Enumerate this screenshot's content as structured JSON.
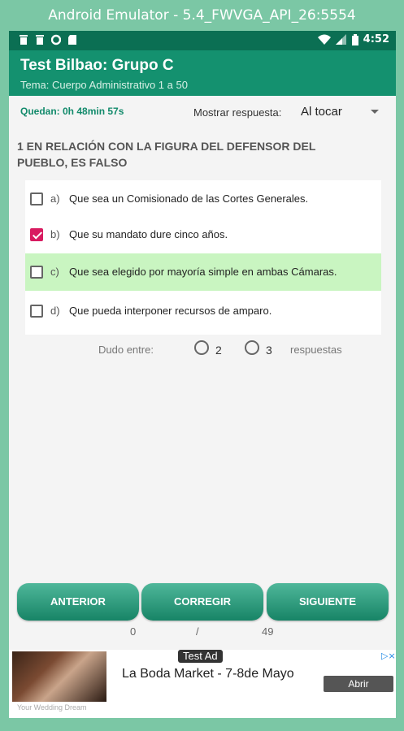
{
  "window": {
    "title": "Android Emulator - 5.4_FWVGA_API_26:5554"
  },
  "status_bar": {
    "time": "4:52",
    "icons": [
      "trash-icon",
      "trash-icon",
      "circle-icon",
      "sim-card-icon",
      "wifi-icon",
      "signal-icon",
      "battery-icon"
    ]
  },
  "app_bar": {
    "title": "Test Bilbao:  Grupo C",
    "subtitle": "Tema: Cuerpo Administrativo 1 a 50",
    "color": "#14916f"
  },
  "timer": {
    "label": "Quedan:  0h 48min 57s"
  },
  "show_answer": {
    "label": "Mostrar respuesta:",
    "value": "Al tocar"
  },
  "question": {
    "text": "1 EN RELACIÓN CON LA FIGURA DEL DEFENSOR DEL PUEBLO, ES FALSO"
  },
  "options": [
    {
      "letter": "a)",
      "text": "Que sea un Comisionado de las Cortes Generales.",
      "checked": false,
      "highlighted": false
    },
    {
      "letter": "b)",
      "text": "Que su mandato dure cinco años.",
      "checked": true,
      "highlighted": false
    },
    {
      "letter": "c)",
      "text": "Que sea elegido por mayoría simple en ambas Cámaras.",
      "checked": false,
      "highlighted": true
    },
    {
      "letter": "d)",
      "text": "Que pueda interponer recursos de amparo.",
      "checked": false,
      "highlighted": false
    }
  ],
  "dudo": {
    "label": "Dudo entre:",
    "option_2": "2",
    "option_3": "3",
    "suffix": "respuestas"
  },
  "buttons": {
    "anterior": "ANTERIOR",
    "corregir": "CORREGIR",
    "siguiente": "SIGUIENTE"
  },
  "pager": {
    "current": "0",
    "separator": "/",
    "total": "49"
  },
  "ad": {
    "badge": "Test Ad",
    "title": "La Boda Market - 7-8de Mayo",
    "button": "Abrir",
    "caption": "Your Wedding Dream"
  }
}
